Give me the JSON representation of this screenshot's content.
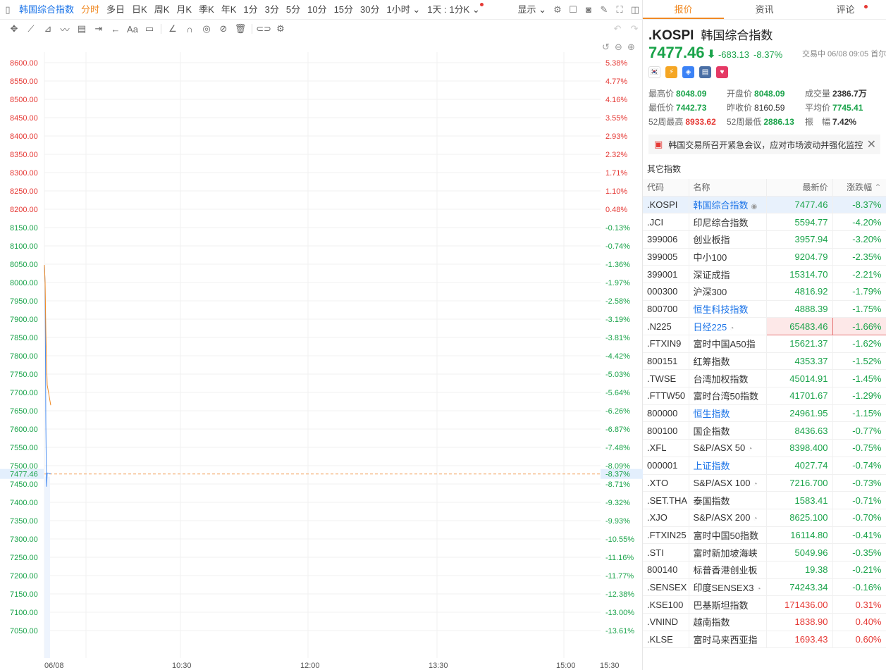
{
  "toolbar": {
    "title": "韩国综合指数",
    "periods": [
      "分时",
      "多日",
      "日K",
      "周K",
      "月K",
      "季K",
      "年K",
      "1分",
      "3分",
      "5分",
      "10分",
      "15分",
      "30分",
      "1小时"
    ],
    "period_active": "分时",
    "range": "1天 : 1分K",
    "display": "显示"
  },
  "chart": {
    "price_ticks": [
      "8600.00",
      "8550.00",
      "8500.00",
      "8450.00",
      "8400.00",
      "8350.00",
      "8300.00",
      "8250.00",
      "8200.00",
      "8150.00",
      "8100.00",
      "8050.00",
      "8000.00",
      "7950.00",
      "7900.00",
      "7850.00",
      "7800.00",
      "7750.00",
      "7700.00",
      "7650.00",
      "7600.00",
      "7550.00",
      "7500.00",
      "7450.00",
      "7400.00",
      "7350.00",
      "7300.00",
      "7250.00",
      "7200.00",
      "7150.00",
      "7100.00",
      "7050.00"
    ],
    "pct_ticks": [
      "5.38%",
      "4.77%",
      "4.16%",
      "3.55%",
      "2.93%",
      "2.32%",
      "1.71%",
      "1.10%",
      "0.48%",
      "-0.13%",
      "-0.74%",
      "-1.36%",
      "-1.97%",
      "-2.58%",
      "-3.19%",
      "-3.81%",
      "-4.42%",
      "-5.03%",
      "-5.64%",
      "-6.26%",
      "-6.87%",
      "-7.48%",
      "-8.09%",
      "-8.71%",
      "-9.32%",
      "-9.93%",
      "-10.55%",
      "-11.16%",
      "-11.77%",
      "-12.38%",
      "-13.00%",
      "-13.61%"
    ],
    "current_price": "7477.46",
    "current_pct": "-8.37%",
    "time_labels": [
      "06/08",
      "10:30",
      "12:00",
      "13:30",
      "15:00",
      "15:30"
    ],
    "prev_close": 8160.59,
    "colors": {
      "up": "#e53935",
      "down": "#1aa34a",
      "price_line": "#4a8df0",
      "avg_line": "#f08a24"
    }
  },
  "chart_data": {
    "type": "line",
    "title": "",
    "xlabel": "",
    "ylabel": "",
    "ylim": [
      7050,
      8600
    ],
    "x": [
      "09:00",
      "09:01",
      "09:02",
      "09:03",
      "09:04",
      "09:05"
    ],
    "series": [
      {
        "name": "",
        "values": [
          8048.09,
          7995.0,
          7620.0,
          7442.73,
          7480.0,
          7477.46
        ]
      },
      {
        "name": "",
        "values": [
          8048.09,
          8000.0,
          7870.0,
          7780.0,
          7720.0,
          7665.0
        ]
      }
    ]
  },
  "panel": {
    "tabs": [
      "报价",
      "资讯",
      "评论"
    ],
    "code": ".KOSPI",
    "name": "韩国综合指数",
    "price": "7477.46",
    "arrow": "⬇",
    "change": "-683.13",
    "change_pct": "-8.37%",
    "status": "交易中 06/08 09:05 首尔",
    "stats": [
      {
        "k": "最高价",
        "v": "8048.09",
        "c": "g"
      },
      {
        "k": "开盘价",
        "v": "8048.09",
        "c": "g"
      },
      {
        "k": "成交量",
        "v": "2386.7万",
        "c": "d"
      },
      {
        "k": "最低价",
        "v": "7442.73",
        "c": "g"
      },
      {
        "k": "昨收价",
        "v": "8160.59",
        "c": "n"
      },
      {
        "k": "平均价",
        "v": "7745.41",
        "c": "g"
      },
      {
        "k": "52周最高",
        "v": "8933.62",
        "c": "r"
      },
      {
        "k": "52周最低",
        "v": "2886.13",
        "c": "g"
      },
      {
        "k": "振　幅",
        "v": "7.42%",
        "c": "d"
      }
    ],
    "notice": "韩国交易所召开紧急会议，应对市场波动并强化监控",
    "other_title": "其它指数",
    "headers": [
      "代码",
      "名称",
      "最新价",
      "涨跌幅"
    ],
    "rows": [
      {
        "code": ".KOSPI",
        "name": "韩国综合指数",
        "price": "7477.46",
        "pct": "-8.37%",
        "link": true,
        "icon": "◉",
        "sel": true
      },
      {
        "code": ".JCI",
        "name": "印尼综合指数",
        "price": "5594.77",
        "pct": "-4.20%"
      },
      {
        "code": "399006",
        "name": "创业板指",
        "price": "3957.94",
        "pct": "-3.20%"
      },
      {
        "code": "399005",
        "name": "中小100",
        "price": "9204.79",
        "pct": "-2.35%"
      },
      {
        "code": "399001",
        "name": "深证成指",
        "price": "15314.70",
        "pct": "-2.21%"
      },
      {
        "code": "000300",
        "name": "沪深300",
        "price": "4816.92",
        "pct": "-1.79%"
      },
      {
        "code": "800700",
        "name": "恒生科技指数",
        "price": "4888.39",
        "pct": "-1.75%",
        "link": true
      },
      {
        "code": ".N225",
        "name": "日经225",
        "price": "65483.46",
        "pct": "-1.66%",
        "link": true,
        "icon": "◔",
        "hl": true
      },
      {
        "code": ".FTXIN9",
        "name": "富时中国A50指",
        "price": "15621.37",
        "pct": "-1.62%"
      },
      {
        "code": "800151",
        "name": "红筹指数",
        "price": "4353.37",
        "pct": "-1.52%"
      },
      {
        "code": ".TWSE",
        "name": "台湾加权指数",
        "price": "45014.91",
        "pct": "-1.45%"
      },
      {
        "code": ".FTTW50",
        "name": "富时台湾50指数",
        "price": "41701.67",
        "pct": "-1.29%"
      },
      {
        "code": "800000",
        "name": "恒生指数",
        "price": "24961.95",
        "pct": "-1.15%",
        "link": true
      },
      {
        "code": "800100",
        "name": "国企指数",
        "price": "8436.63",
        "pct": "-0.77%"
      },
      {
        "code": ".XFL",
        "name": "S&P/ASX 50",
        "price": "8398.400",
        "pct": "-0.75%",
        "icon": "◔"
      },
      {
        "code": "000001",
        "name": "上证指数",
        "price": "4027.74",
        "pct": "-0.74%",
        "link": true
      },
      {
        "code": ".XTO",
        "name": "S&P/ASX 100",
        "price": "7216.700",
        "pct": "-0.73%",
        "icon": "◔"
      },
      {
        "code": ".SET.THA",
        "name": "泰国指数",
        "price": "1583.41",
        "pct": "-0.71%"
      },
      {
        "code": ".XJO",
        "name": "S&P/ASX 200",
        "price": "8625.100",
        "pct": "-0.70%",
        "icon": "◔"
      },
      {
        "code": ".FTXIN25",
        "name": "富时中国50指数",
        "price": "16114.80",
        "pct": "-0.41%"
      },
      {
        "code": ".STI",
        "name": "富时新加坡海峡",
        "price": "5049.96",
        "pct": "-0.35%"
      },
      {
        "code": "800140",
        "name": "标普香港创业板",
        "price": "19.38",
        "pct": "-0.21%"
      },
      {
        "code": ".SENSEX",
        "name": "印度SENSEX3",
        "price": "74243.34",
        "pct": "-0.16%",
        "icon": "◔"
      },
      {
        "code": ".KSE100",
        "name": "巴基斯坦指数",
        "price": "171436.00",
        "pct": "0.31%",
        "up": true
      },
      {
        "code": ".VNIND",
        "name": "越南指数",
        "price": "1838.90",
        "pct": "0.40%",
        "up": true
      },
      {
        "code": ".KLSE",
        "name": "富时马来西亚指",
        "price": "1693.43",
        "pct": "0.60%",
        "up": true
      }
    ]
  }
}
